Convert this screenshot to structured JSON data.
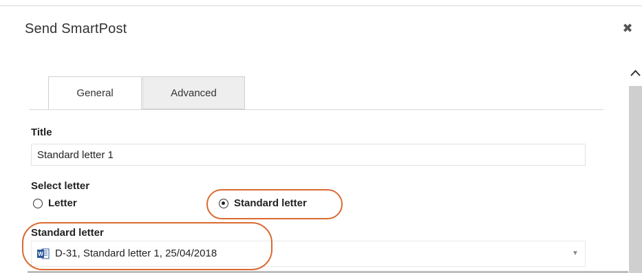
{
  "dialog": {
    "title": "Send SmartPost",
    "close_glyph": "✖"
  },
  "tabs": [
    {
      "label": "General",
      "active": true
    },
    {
      "label": "Advanced",
      "active": false
    }
  ],
  "form": {
    "title_label": "Title",
    "title_value": "Standard letter 1",
    "select_letter_label": "Select letter",
    "radio_options": [
      {
        "label": "Letter",
        "selected": false
      },
      {
        "label": "Standard letter",
        "selected": true
      }
    ],
    "standard_letter_label": "Standard letter",
    "standard_letter_value": "D-31, Standard letter 1, 25/04/2018",
    "dropdown_caret": "▼"
  },
  "icons": {
    "close": "close-icon",
    "scroll_up": "chevron-up-icon",
    "document": "word-document-icon",
    "dropdown": "chevron-down-icon"
  },
  "colors": {
    "highlight": "#d9692f",
    "word_blue": "#2b579a",
    "scrollbar": "#cfcfcf",
    "inactive_tab": "#eeeeee"
  }
}
